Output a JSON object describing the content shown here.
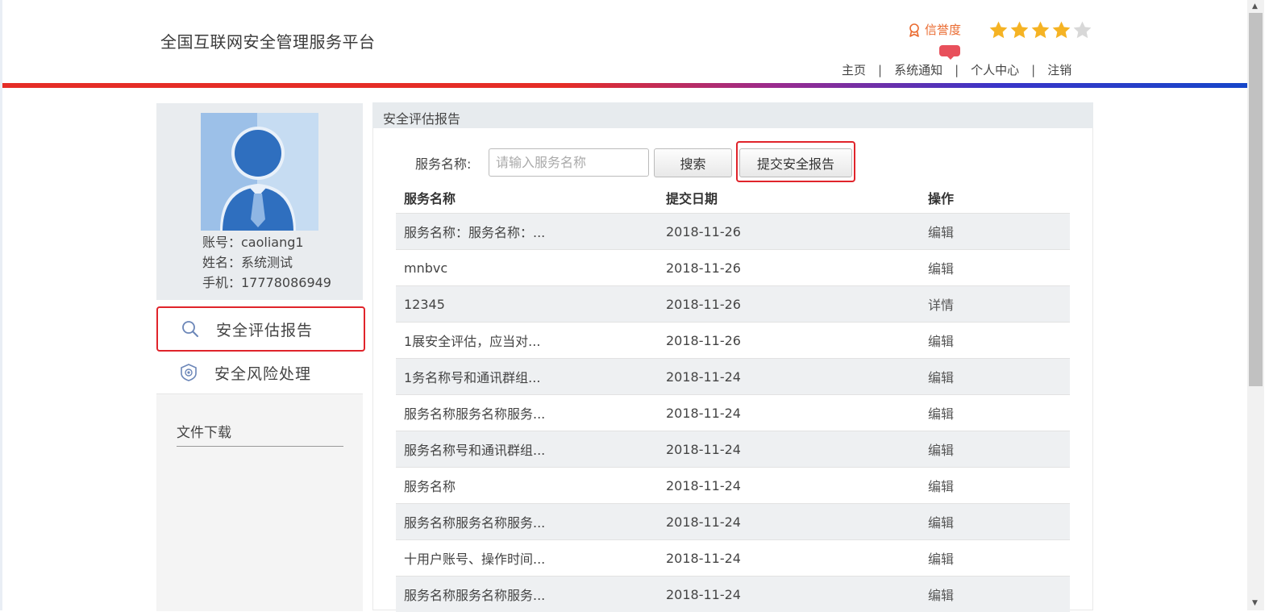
{
  "header": {
    "site_title": "全国互联网安全管理服务平台",
    "credit_label": "信誉度",
    "rating": 4,
    "rating_max": 5,
    "nav": [
      "主页",
      "系统通知",
      "个人中心",
      "注销"
    ],
    "nav_separator": "|"
  },
  "profile": {
    "account": "账号：caoliang1",
    "name": "姓名：系统测试",
    "phone": "手机：17778086949"
  },
  "sidebar": {
    "items": [
      {
        "label": "安全评估报告",
        "icon": "search-icon",
        "active": true
      },
      {
        "label": "安全风险处理",
        "icon": "shield-icon",
        "active": false
      }
    ],
    "downloads": "文件下载"
  },
  "main": {
    "panel_title": "安全评估报告",
    "search_label": "服务名称:",
    "search_placeholder": "请输入服务名称",
    "search_button": "搜索",
    "submit_button": "提交安全报告",
    "columns": [
      "服务名称",
      "提交日期",
      "操作"
    ],
    "rows": [
      {
        "name": "服务名称：服务名称：...",
        "date": "2018-11-26",
        "action": "编辑"
      },
      {
        "name": "mnbvc",
        "date": "2018-11-26",
        "action": "编辑"
      },
      {
        "name": "12345",
        "date": "2018-11-26",
        "action": "详情"
      },
      {
        "name": "1展安全评估，应当对...",
        "date": "2018-11-26",
        "action": "编辑"
      },
      {
        "name": "1务名称号和通讯群组...",
        "date": "2018-11-24",
        "action": "编辑"
      },
      {
        "name": "服务名称服务名称服务...",
        "date": "2018-11-24",
        "action": "编辑"
      },
      {
        "name": "服务名称号和通讯群组...",
        "date": "2018-11-24",
        "action": "编辑"
      },
      {
        "name": "服务名称",
        "date": "2018-11-24",
        "action": "编辑"
      },
      {
        "name": "服务名称服务名称服务...",
        "date": "2018-11-24",
        "action": "编辑"
      },
      {
        "name": "十用户账号、操作时间...",
        "date": "2018-11-24",
        "action": "编辑"
      },
      {
        "name": "服务名称服务名称服务...",
        "date": "2018-11-24",
        "action": "编辑"
      }
    ]
  },
  "colors": {
    "accent_red": "#e0242b",
    "credit_orange": "#ea6a2f",
    "star_gold": "#f5b324",
    "star_empty": "#d8d8d8",
    "badge_red": "#e8505b"
  }
}
